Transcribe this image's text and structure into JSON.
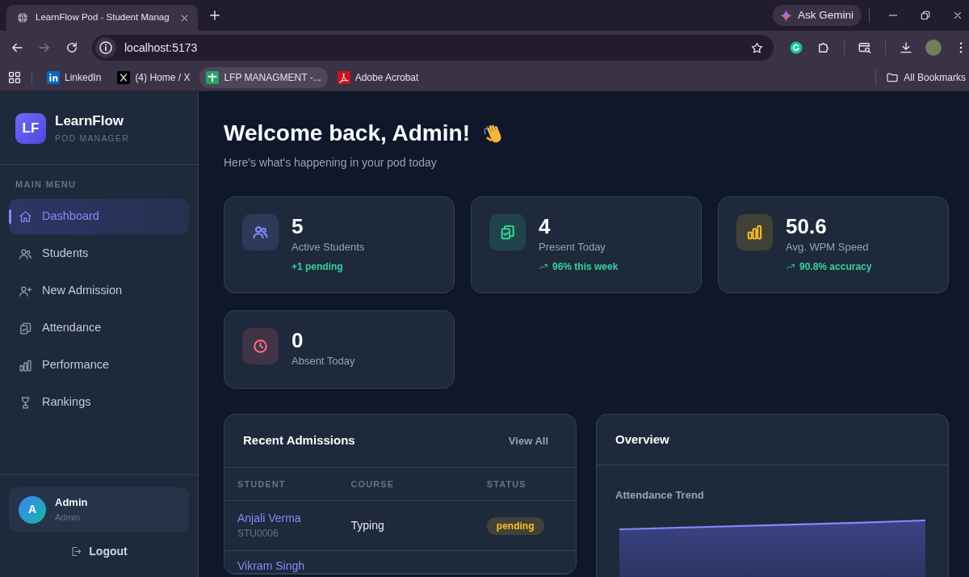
{
  "browser": {
    "tab_title": "LearnFlow Pod - Student Manag",
    "ask_button": "Ask Gemini",
    "forward_disabled": true,
    "address": "localhost:5173",
    "bookmarks": [
      {
        "kind": "linkedin",
        "label": "LinkedIn",
        "selected": false
      },
      {
        "kind": "x",
        "label": "(4) Home / X",
        "selected": false
      },
      {
        "kind": "sheets",
        "label": "LFP MANAGMENT -...",
        "selected": true
      },
      {
        "kind": "acrobat",
        "label": "Adobe Acrobat",
        "selected": false
      }
    ],
    "all_bookmarks": "All Bookmarks"
  },
  "sidebar": {
    "logo": "LF",
    "brand": "LearnFlow",
    "tagline": "POD MANAGER",
    "section": "MAIN MENU",
    "items": [
      {
        "kind": "home",
        "label": "Dashboard",
        "selected": true
      },
      {
        "kind": "users",
        "label": "Students",
        "selected": false
      },
      {
        "kind": "user-plus",
        "label": "New Admission",
        "selected": false
      },
      {
        "kind": "clipboard",
        "label": "Attendance",
        "selected": false
      },
      {
        "kind": "bars",
        "label": "Performance",
        "selected": false
      },
      {
        "kind": "trophy",
        "label": "Rankings",
        "selected": false
      }
    ],
    "user": {
      "initial": "A",
      "name": "Admin",
      "role": "Admin"
    },
    "logout": "Logout"
  },
  "main": {
    "heading": "Welcome back, Admin!",
    "subtitle": "Here's what's happening in your pod today",
    "stats": [
      {
        "kind": "users",
        "color": "#818cf8",
        "value": "5",
        "label": "Active Students",
        "note": "+1 pending",
        "trend": false
      },
      {
        "kind": "clipboard",
        "color": "#34d399",
        "value": "4",
        "label": "Present Today",
        "note": "96% this week",
        "trend": true
      },
      {
        "kind": "bars",
        "color": "#fbbf24",
        "value": "50.6",
        "label": "Avg. WPM Speed",
        "note": "90.8% accuracy",
        "trend": true
      },
      {
        "kind": "clock",
        "color": "#fb7185",
        "value": "0",
        "label": "Absent Today"
      }
    ],
    "recent": {
      "title": "Recent Admissions",
      "view_all": "View All",
      "columns": [
        "STUDENT",
        "COURSE",
        "STATUS"
      ],
      "rows": [
        {
          "name": "Anjali Verma",
          "student_id": "STU0006",
          "course": "Typing",
          "status": "pending"
        },
        {
          "name": "Vikram Singh"
        }
      ]
    },
    "overview": {
      "title": "Overview",
      "chart_title": "Attendance Trend"
    }
  }
}
